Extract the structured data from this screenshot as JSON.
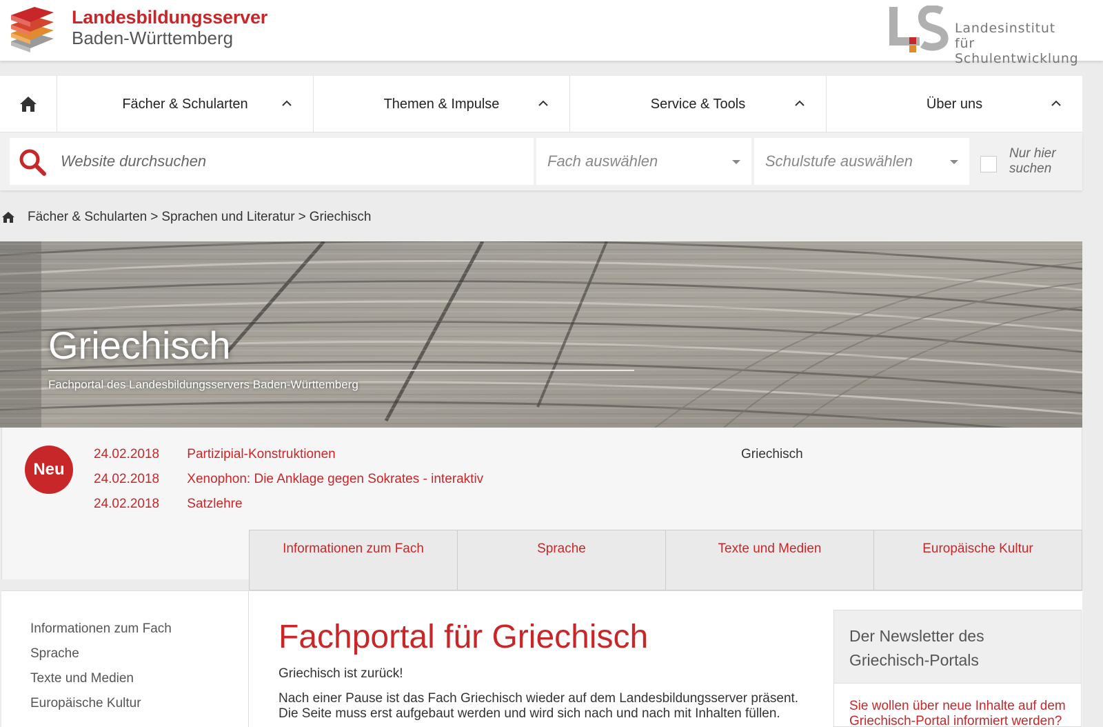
{
  "brand": {
    "title": "Landesbildungsserver",
    "subtitle": "Baden-Württemberg",
    "partner_line1": "Landesinstitut",
    "partner_line2": "für Schulentwicklung"
  },
  "nav": {
    "items": [
      {
        "label": "Fächer & Schularten"
      },
      {
        "label": "Themen & Impulse"
      },
      {
        "label": "Service & Tools"
      },
      {
        "label": "Über uns"
      }
    ]
  },
  "search": {
    "placeholder": "Website durchsuchen",
    "subject_select": "Fach auswählen",
    "level_select": "Schulstufe auswählen",
    "only_here_label": "Nur hier suchen"
  },
  "breadcrumb": {
    "items": [
      "Fächer & Schularten",
      "Sprachen und Literatur",
      "Griechisch"
    ],
    "separator": ">"
  },
  "hero": {
    "title": "Griechisch",
    "subtitle": "Fachportal des Landesbildungsservers Baden-Württemberg"
  },
  "news": {
    "badge": "Neu",
    "side_label": "Griechisch",
    "items": [
      {
        "date": "24.02.2018",
        "title": "Partizipial-Konstruktionen"
      },
      {
        "date": "24.02.2018",
        "title": "Xenophon: Die Anklage gegen Sokrates - interaktiv"
      },
      {
        "date": "24.02.2018",
        "title": "Satzlehre"
      }
    ]
  },
  "tabs": [
    {
      "label": "Informationen zum Fach"
    },
    {
      "label": "Sprache"
    },
    {
      "label": "Texte und Medien"
    },
    {
      "label": "Europäische Kultur"
    }
  ],
  "sidebar": {
    "items": [
      {
        "label": "Informationen zum Fach"
      },
      {
        "label": "Sprache"
      },
      {
        "label": "Texte und Medien"
      },
      {
        "label": "Europäische Kultur"
      }
    ]
  },
  "main": {
    "title": "Fachportal für Griechisch",
    "intro": "Griechisch ist zurück!",
    "body_line1": "Nach einer Pause ist das Fach Griechisch wieder auf dem Landesbildungsserver präsent.",
    "body_line2": "Die Seite muss erst aufgebaut werden und wird sich nach und nach mit Inhalten füllen."
  },
  "newsletter": {
    "heading_line1": "Der Newsletter des",
    "heading_line2": "Griechisch-Portals",
    "text": "Sie wollen über neue Inhalte auf dem Griechisch-Portal informiert werden?"
  },
  "colors": {
    "accent": "#c8272a",
    "background": "#ececec",
    "tab_background": "#eaeaea"
  }
}
